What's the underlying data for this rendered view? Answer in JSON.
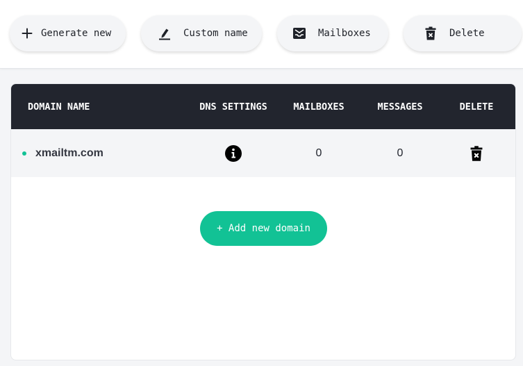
{
  "toolbar": {
    "generate": {
      "label": "Generate new",
      "icon": "plus-icon"
    },
    "custom": {
      "label": "Custom name",
      "icon": "pen-icon"
    },
    "mailboxes": {
      "label": "Mailboxes",
      "icon": "inbox-icon"
    },
    "delete": {
      "label": "Delete",
      "icon": "trash-icon"
    }
  },
  "table": {
    "headers": {
      "domain": "DOMAIN NAME",
      "dns": "DNS SETTINGS",
      "mailboxes": "MAILBOXES",
      "messages": "MESSAGES",
      "delete": "DELETE"
    },
    "rows": [
      {
        "domain": "xmailtm.com",
        "mailboxes": "0",
        "messages": "0",
        "dns_icon": "info-icon",
        "delete_icon": "trash-icon"
      }
    ]
  },
  "add_domain": {
    "label": "+ Add new domain"
  },
  "colors": {
    "accent": "#12c295",
    "header_bg": "#22252e",
    "page_bg": "#f4f5f7"
  }
}
